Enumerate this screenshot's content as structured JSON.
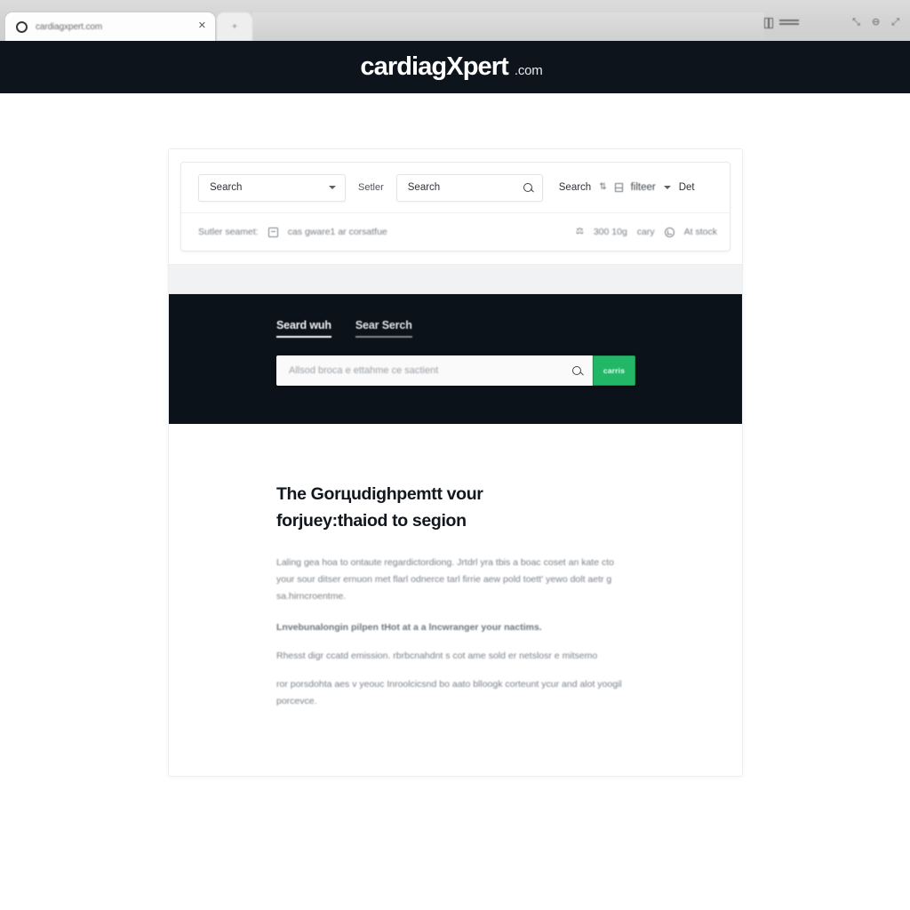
{
  "browser": {
    "tab_title": "cardiagxpert.com",
    "tab_close_glyph": "✕",
    "new_tab_glyph": "+",
    "toolbar_icons": [
      "book-icon",
      "menu-bars-icon"
    ],
    "window_icons": [
      "minimize-icon",
      "restore-icon",
      "close-icon"
    ]
  },
  "header": {
    "logo_main": "cardiagXpert",
    "logo_tld": ".com",
    "background": "#0d141c"
  },
  "toolbar": {
    "category_select": {
      "value": "Search",
      "chevron": "chevron-down-icon"
    },
    "seller_label": "Setler",
    "keyword_search": {
      "value": "Search",
      "placeholder": "Search"
    },
    "tail": {
      "search_label": "Search",
      "filter_label": "filteer",
      "chevron": "chevron-down-icon",
      "detail_label": "Det"
    },
    "meta_row": {
      "left_text": "Sutler seamet:",
      "note_text": "cas gware1 ar corsatfue",
      "quantity": "300 10g",
      "unit": "cary",
      "stock_status": "At stock"
    }
  },
  "hero": {
    "tabs": [
      {
        "label": "Seard wuh",
        "state": "active"
      },
      {
        "label": "Sear Serch",
        "state": "inactive"
      }
    ],
    "search": {
      "placeholder": "Allsod broca e ettahme ce sactient",
      "icon": "search-icon"
    },
    "cta_label": "carris",
    "cta_color": "#22b767",
    "background": "#0b1219"
  },
  "article": {
    "heading_line1": "The Gorцudighpemtt vour",
    "heading_line2": "forjuey:thaiod to segion",
    "paragraphs": [
      "Laling gea hoa to ontaute regardictordiong. Jrtdrl yra tbis a boac coset an kate cto your sour ditser ernuon met flarl odnerce tarl firrie aew pold toett' yewo dolt aetr g sa.hirncroentme.",
      "Lnvebunalongin pilpen tHot at a a lncwranger your nactims.",
      "Rhesst digr ccatd emission. rbrbcnahdnt s cot ame sold er netslosr e mitsemo",
      "ror porsdohta aes v yeouc Inroolcicsnd bo aato blloogk corteunt ycur and alot yoogil porcevce."
    ]
  }
}
